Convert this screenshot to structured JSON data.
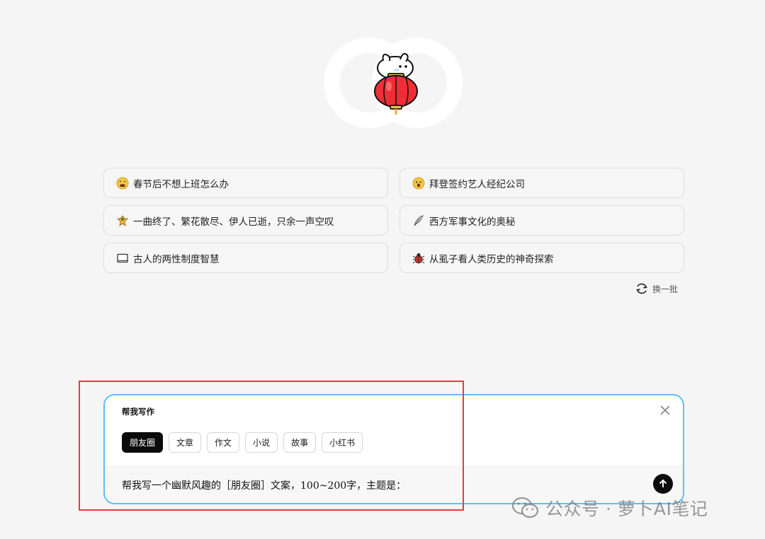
{
  "suggestions": [
    {
      "icon": "tired-face-icon",
      "label": "春节后不想上班怎么办"
    },
    {
      "icon": "surprised-face-icon",
      "label": "拜登签约艺人经纪公司"
    },
    {
      "icon": "ghost-icon",
      "label": "一曲终了、繁花散尽、伊人已逝，只余一声空叹"
    },
    {
      "icon": "quill-icon",
      "label": "西方军事文化的奥秘"
    },
    {
      "icon": "book-icon",
      "label": "古人的两性制度智慧"
    },
    {
      "icon": "bug-icon",
      "label": "从虱子看人类历史的神奇探索"
    }
  ],
  "refresh_label": "换一批",
  "write_panel": {
    "title": "帮我写作",
    "tabs": [
      "朋友圈",
      "文章",
      "作文",
      "小说",
      "故事",
      "小红书"
    ],
    "active_tab": 0,
    "input_text": "帮我写一个幽默风趣的［朋友圈］文案，100~200字，主题是："
  },
  "watermark": "公众号 · 萝卜AI笔记",
  "colors": {
    "accent_border": "#5cc2f2",
    "highlight": "#e33c3c",
    "active_tab": "#0b0b0b"
  }
}
